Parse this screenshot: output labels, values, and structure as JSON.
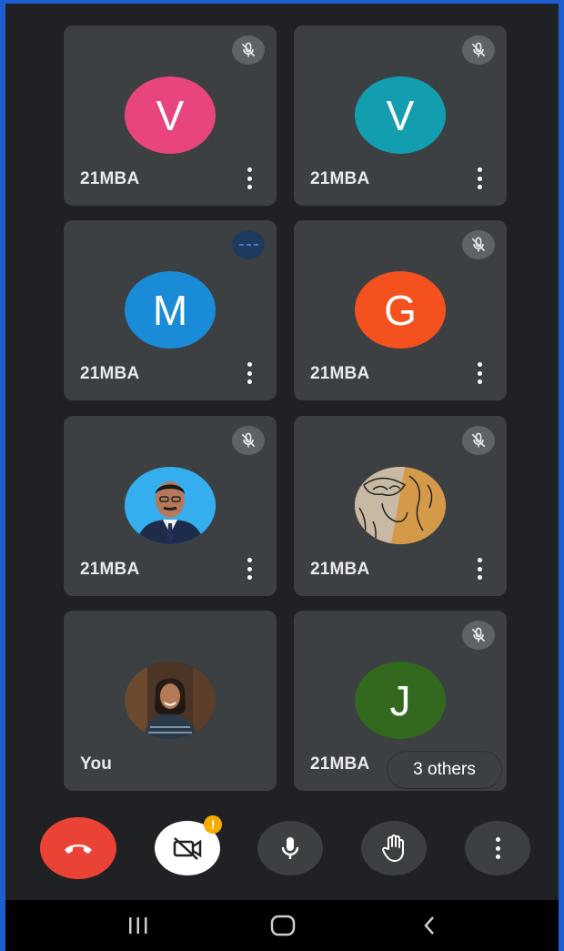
{
  "participants": [
    {
      "name": "21MBA",
      "avatar_letter": "V",
      "avatar_color": "#e8457e",
      "muted": true
    },
    {
      "name": "21MBA",
      "avatar_letter": "V",
      "avatar_color": "#129eaf",
      "muted": true
    },
    {
      "name": "21MBA",
      "avatar_letter": "M",
      "avatar_color": "#1a8bd6",
      "speaking": true
    },
    {
      "name": "21MBA",
      "avatar_letter": "G",
      "avatar_color": "#f4511e",
      "muted": true
    },
    {
      "name": "21MBA",
      "avatar_photo": "man-portrait",
      "muted": true
    },
    {
      "name": "21MBA",
      "avatar_photo": "sketch-art",
      "muted": true
    },
    {
      "name": "You",
      "avatar_photo": "woman-portrait",
      "muted": false
    },
    {
      "name": "21MBA",
      "avatar_letter": "J",
      "avatar_color": "#33691e",
      "muted": true
    }
  ],
  "others_chip": "3 others",
  "controls": {
    "end_call": "phone-hangup-icon",
    "camera": "camera-off-icon",
    "camera_badge": "!",
    "mic": "microphone-icon",
    "raise_hand": "hand-icon",
    "more": "more-vert-icon"
  },
  "colors": {
    "background": "#202124",
    "tile": "#3c4043",
    "end_call": "#ea4335",
    "badge": "#f9ab00"
  }
}
